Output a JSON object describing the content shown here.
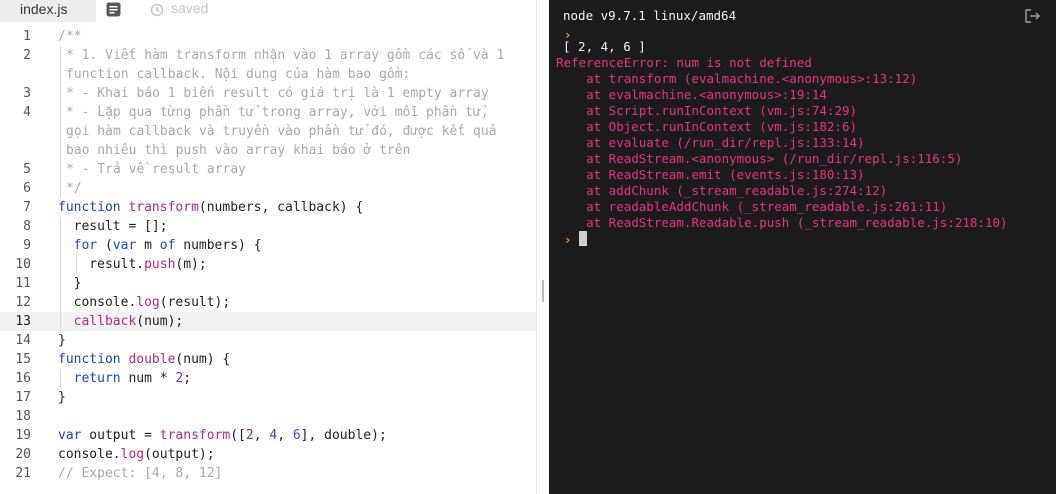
{
  "editor": {
    "tab_label": "index.js",
    "saved_label": "saved",
    "lines": [
      {
        "num": "1",
        "text": "/**",
        "kind": "cm"
      },
      {
        "num": "2",
        "text": "* 1. Viết hàm transform nhận vào 1 array gồm các số và 1",
        "kind": "cm"
      },
      {
        "num": "",
        "text": "function callback. Nội dung của hàm bao gồm:",
        "kind": "cm"
      },
      {
        "num": "3",
        "text": "* - Khai báo 1 biến result có giá trị là 1 empty array",
        "kind": "cm"
      },
      {
        "num": "4",
        "text": "* - Lặp qua từng phần tử trong array, với mỗi phần tử,",
        "kind": "cm"
      },
      {
        "num": "",
        "text": "gọi hàm callback và truyền vào phần tử đó, được kết quả",
        "kind": "cm"
      },
      {
        "num": "",
        "text": "bao nhiêu thì push vào array khai báo ở trên",
        "kind": "cm"
      },
      {
        "num": "5",
        "text": "* - Trả về result array",
        "kind": "cm"
      },
      {
        "num": "6",
        "text": "*/",
        "kind": "cm"
      },
      {
        "num": "7",
        "text": "function transform(numbers, callback) {",
        "kind": "code"
      },
      {
        "num": "8",
        "text": "  result = [];",
        "kind": "code"
      },
      {
        "num": "9",
        "text": "  for (var m of numbers) {",
        "kind": "code"
      },
      {
        "num": "10",
        "text": "    result.push(m);",
        "kind": "code"
      },
      {
        "num": "11",
        "text": "  }",
        "kind": "code"
      },
      {
        "num": "12",
        "text": "  console.log(result);",
        "kind": "code"
      },
      {
        "num": "13",
        "text": "  callback(num);",
        "kind": "code"
      },
      {
        "num": "14",
        "text": "}",
        "kind": "code"
      },
      {
        "num": "15",
        "text": "function double(num) {",
        "kind": "code"
      },
      {
        "num": "16",
        "text": "  return num * 2;",
        "kind": "code"
      },
      {
        "num": "17",
        "text": "}",
        "kind": "code"
      },
      {
        "num": "18",
        "text": "",
        "kind": "code"
      },
      {
        "num": "19",
        "text": "var output = transform([2, 4, 6], double);",
        "kind": "code"
      },
      {
        "num": "20",
        "text": "console.log(output);",
        "kind": "code"
      },
      {
        "num": "21",
        "text": "// Expect: [4, 8, 12]",
        "kind": "cm"
      }
    ]
  },
  "console": {
    "header": "node v9.7.1 linux/amd64",
    "output": "[ 2, 4, 6 ]",
    "error_lines": [
      "ReferenceError: num is not defined",
      "    at transform (evalmachine.<anonymous>:13:12)",
      "    at evalmachine.<anonymous>:19:14",
      "    at Script.runInContext (vm.js:74:29)",
      "    at Object.runInContext (vm.js:182:6)",
      "    at evaluate (/run_dir/repl.js:133:14)",
      "    at ReadStream.<anonymous> (/run_dir/repl.js:116:5)",
      "    at ReadStream.emit (events.js:180:13)",
      "    at addChunk (_stream_readable.js:274:12)",
      "    at readableAddChunk (_stream_readable.js:261:11)",
      "    at ReadStream.Readable.push (_stream_readable.js:218:10)"
    ],
    "prompt_icon": "chevron-right-icon"
  },
  "colors": {
    "console_bg": "#1c1c1c",
    "error": "#e8357a",
    "prompt": "#f5a623",
    "keyword": "#1d45c2",
    "function": "#b0298b",
    "number": "#6f2fb5",
    "comment": "#a9a9a9"
  }
}
